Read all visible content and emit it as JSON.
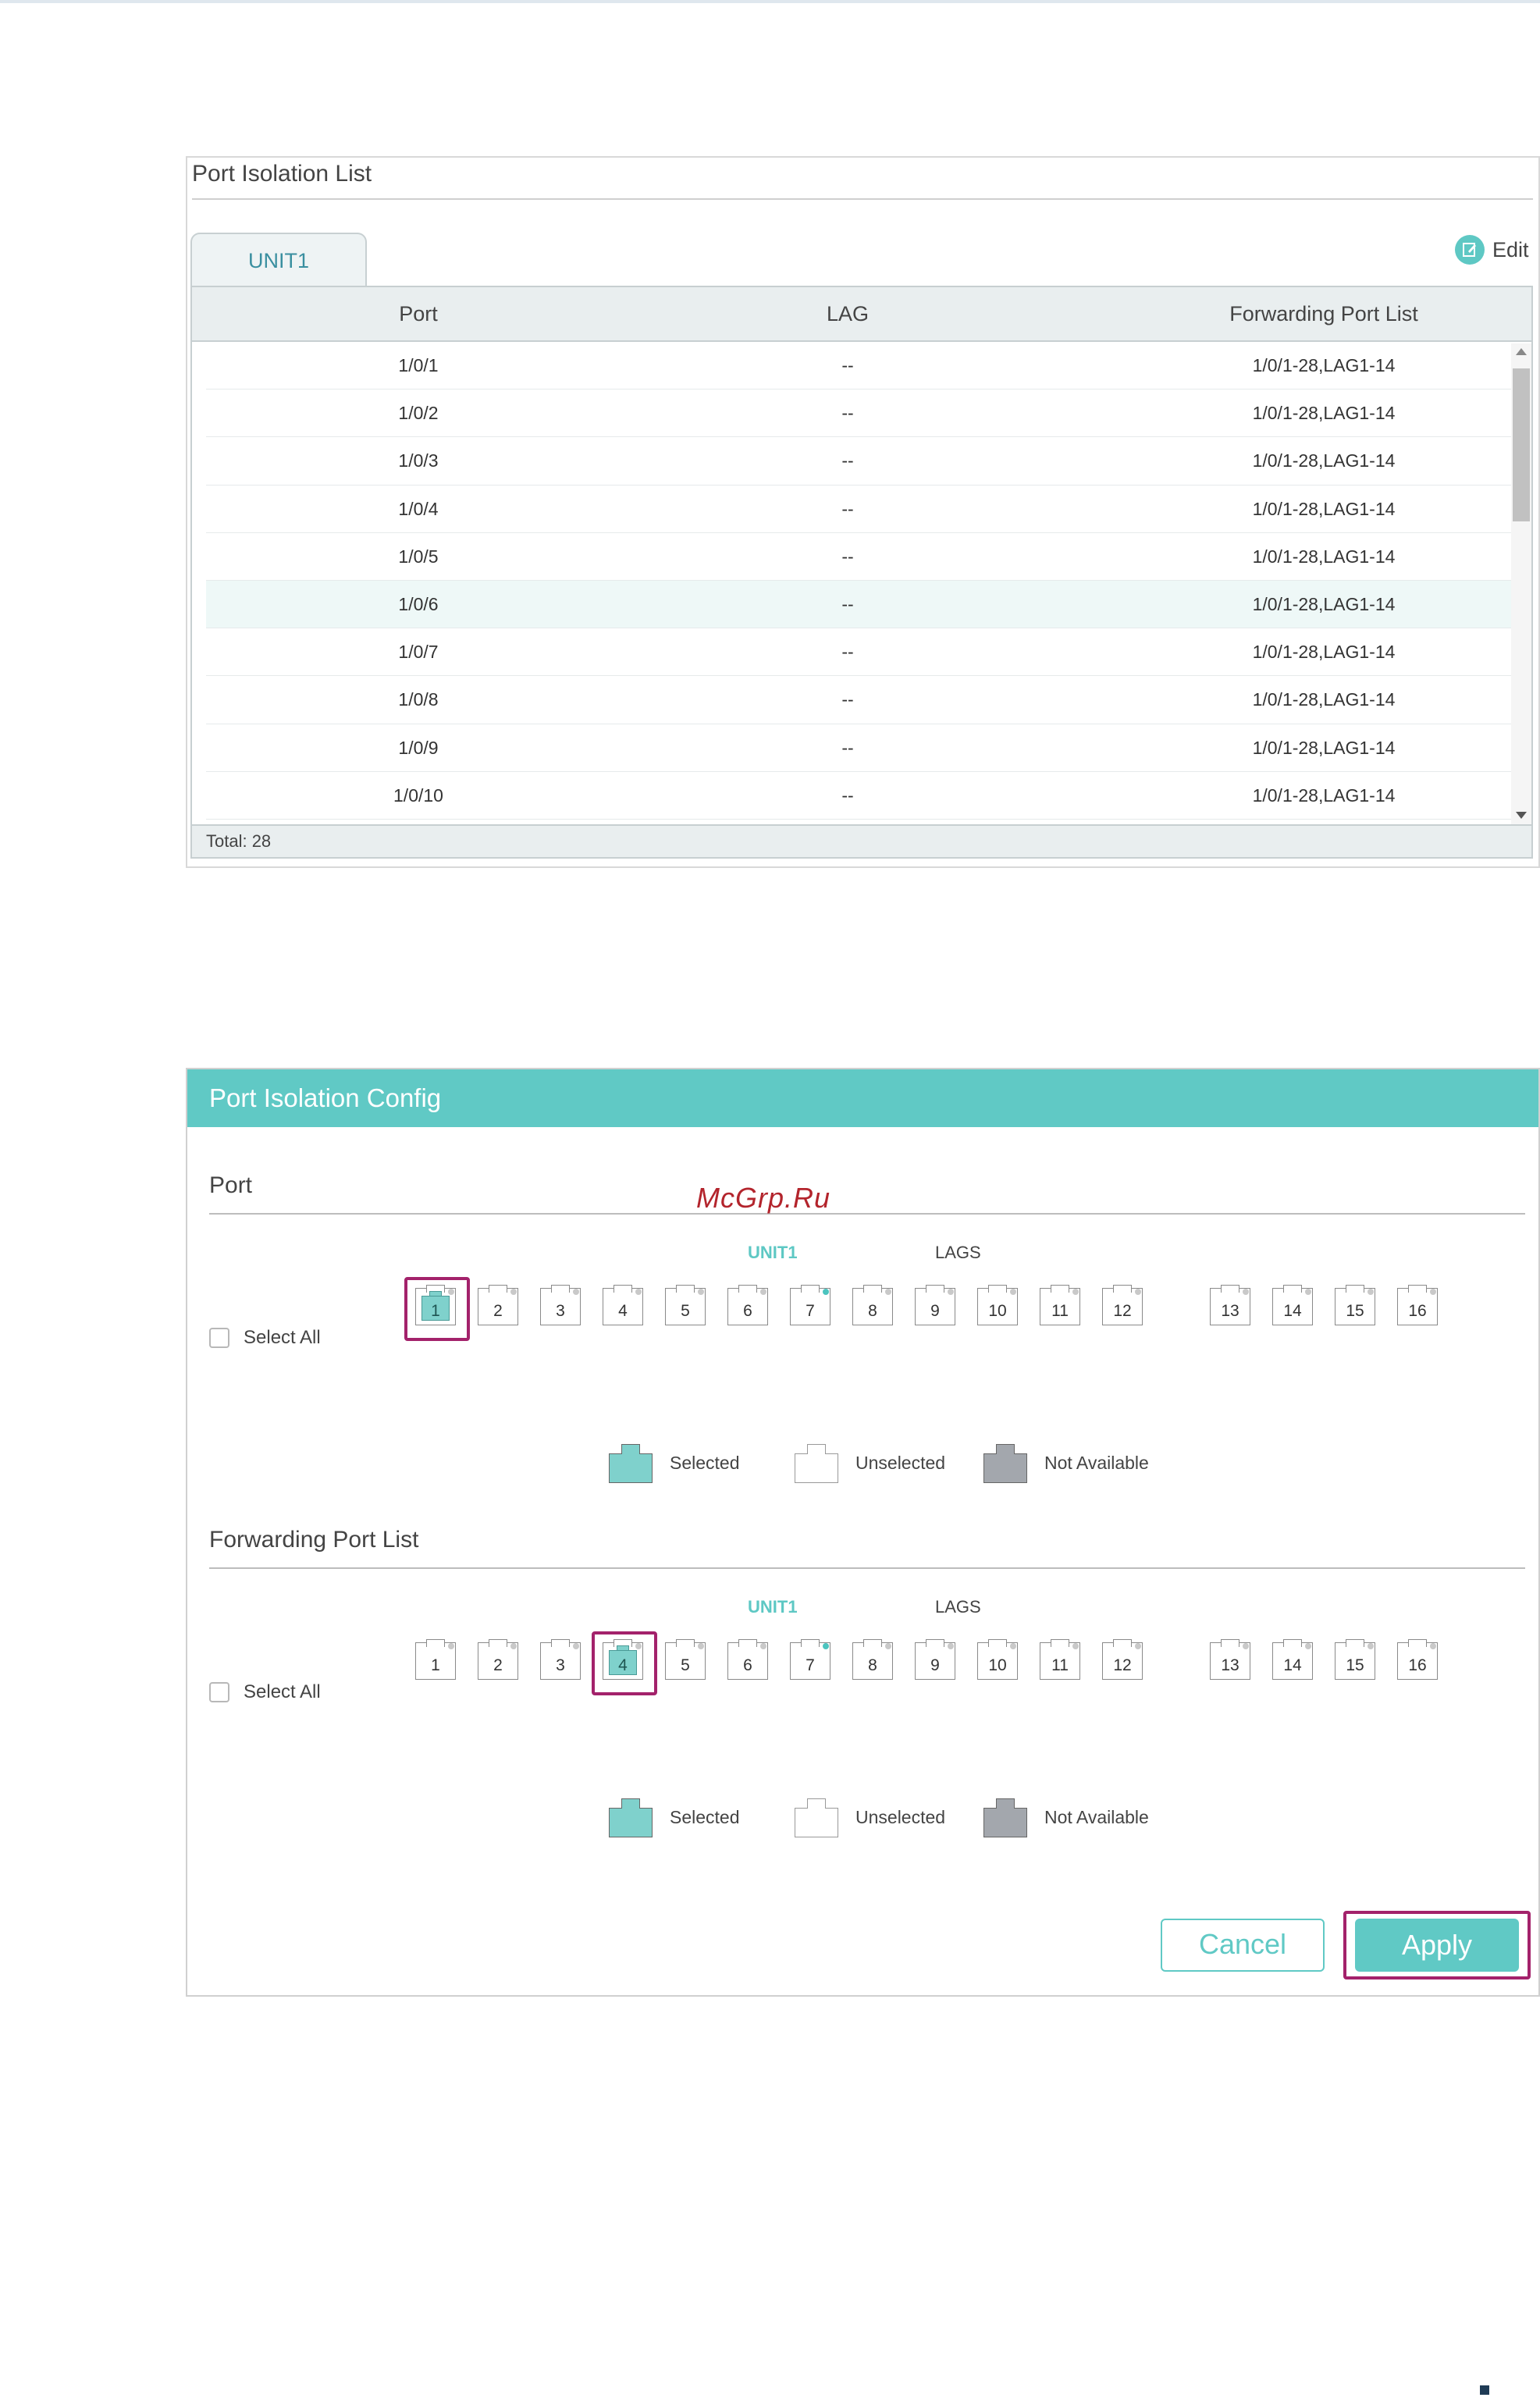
{
  "list_panel": {
    "title": "Port Isolation List",
    "tab": "UNIT1",
    "edit_label": "Edit",
    "columns": [
      "Port",
      "LAG",
      "Forwarding Port List"
    ],
    "rows": [
      {
        "port": "1/0/1",
        "lag": "--",
        "forwarding": "1/0/1-28,LAG1-14"
      },
      {
        "port": "1/0/2",
        "lag": "--",
        "forwarding": "1/0/1-28,LAG1-14"
      },
      {
        "port": "1/0/3",
        "lag": "--",
        "forwarding": "1/0/1-28,LAG1-14"
      },
      {
        "port": "1/0/4",
        "lag": "--",
        "forwarding": "1/0/1-28,LAG1-14"
      },
      {
        "port": "1/0/5",
        "lag": "--",
        "forwarding": "1/0/1-28,LAG1-14"
      },
      {
        "port": "1/0/6",
        "lag": "--",
        "forwarding": "1/0/1-28,LAG1-14"
      },
      {
        "port": "1/0/7",
        "lag": "--",
        "forwarding": "1/0/1-28,LAG1-14"
      },
      {
        "port": "1/0/8",
        "lag": "--",
        "forwarding": "1/0/1-28,LAG1-14"
      },
      {
        "port": "1/0/9",
        "lag": "--",
        "forwarding": "1/0/1-28,LAG1-14"
      },
      {
        "port": "1/0/10",
        "lag": "--",
        "forwarding": "1/0/1-28,LAG1-14"
      }
    ],
    "highlighted_row": "1/0/6",
    "total": "Total: 28"
  },
  "config_panel": {
    "title": "Port Isolation Config",
    "port_section": {
      "title": "Port",
      "unit_label": "UNIT1",
      "lags_label": "LAGS",
      "select_all": "Select All",
      "unit_ports": [
        "1",
        "2",
        "3",
        "4",
        "5",
        "6",
        "7",
        "8",
        "9",
        "10",
        "11",
        "12"
      ],
      "lag_ports": [
        "13",
        "14",
        "15",
        "16"
      ],
      "selected": [
        "1"
      ],
      "active_dot": [
        "7"
      ]
    },
    "forwarding_section": {
      "title": "Forwarding Port List",
      "unit_label": "UNIT1",
      "lags_label": "LAGS",
      "select_all": "Select All",
      "unit_ports": [
        "1",
        "2",
        "3",
        "4",
        "5",
        "6",
        "7",
        "8",
        "9",
        "10",
        "11",
        "12"
      ],
      "lag_ports": [
        "13",
        "14",
        "15",
        "16"
      ],
      "selected": [
        "4"
      ],
      "active_dot": [
        "7"
      ]
    },
    "legend": {
      "selected": "Selected",
      "unselected": "Unselected",
      "not_available": "Not Available"
    },
    "cancel_label": "Cancel",
    "apply_label": "Apply"
  },
  "watermark": "McGrp.Ru",
  "colors": {
    "accent": "#60c9c5",
    "selected_port": "#7fd1cc",
    "not_available_port": "#a3a7ad",
    "highlight_box": "#a3226b"
  }
}
